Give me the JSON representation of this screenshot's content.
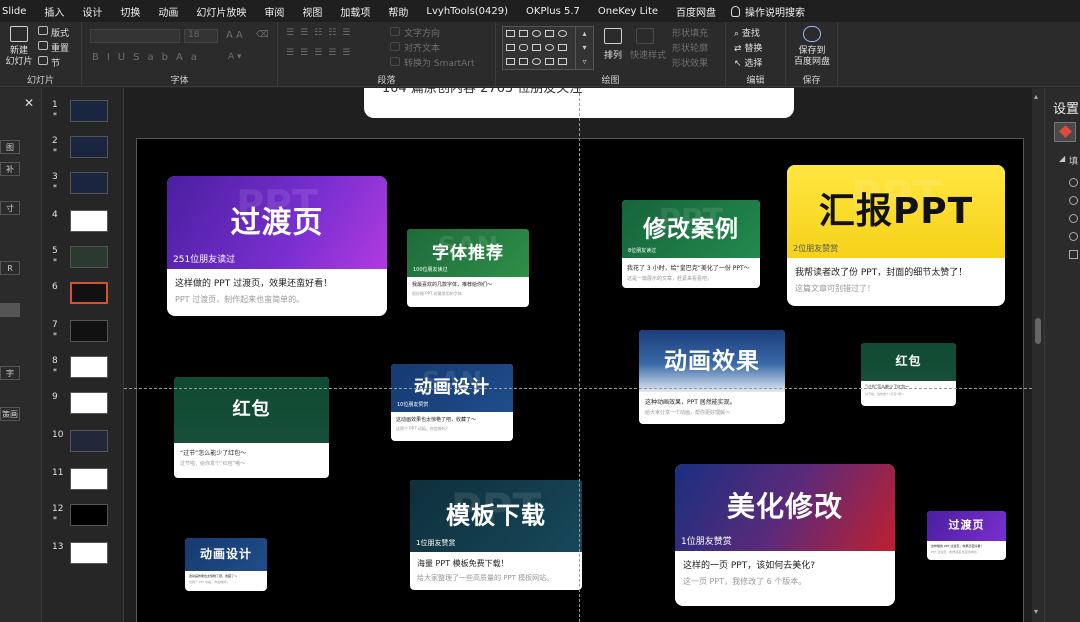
{
  "menu": [
    "Slide",
    "插入",
    "设计",
    "切换",
    "动画",
    "幻灯片放映",
    "审阅",
    "视图",
    "加载项",
    "帮助",
    "LvyhTools(0429)",
    "OKPlus 5.7",
    "OneKey Lite",
    "百度网盘"
  ],
  "tell_me": "操作说明搜索",
  "ribbon": {
    "new_slide": "新建\n幻灯片",
    "layout": "版式",
    "reset": "重置",
    "section": "节",
    "group_slides": "幻灯片",
    "font_size": "18",
    "group_font": "字体",
    "text_direction": "文字方向",
    "align_text": "对齐文本",
    "smartart": "转换为 SmartArt",
    "group_paragraph": "段落",
    "arrange": "排列",
    "quick_styles": "快速样式",
    "shape_fill": "形状填充",
    "shape_outline": "形状轮廓",
    "shape_effects": "形状效果",
    "group_drawing": "绘图",
    "find": "查找",
    "replace": "替换",
    "select": "选择",
    "group_editing": "编辑",
    "save_to": "保存到\n百度网盘",
    "group_save": "保存"
  },
  "left_panel": {
    "buttons": [
      "图",
      "补",
      "寸",
      "R",
      "字",
      "策画"
    ]
  },
  "right_panel": {
    "title": "设置",
    "sub": "填"
  },
  "thumbnails": [
    {
      "num": "1",
      "star": true,
      "bg": "#1a2540"
    },
    {
      "num": "2",
      "star": true,
      "bg": "#1a2540"
    },
    {
      "num": "3",
      "star": true,
      "bg": "#1a2540"
    },
    {
      "num": "4",
      "star": false,
      "bg": "#ffffff"
    },
    {
      "num": "5",
      "star": true,
      "bg": "#2a3a30"
    },
    {
      "num": "6",
      "star": false,
      "bg": "#111111",
      "selected": true
    },
    {
      "num": "7",
      "star": true,
      "bg": "#111111"
    },
    {
      "num": "8",
      "star": true,
      "bg": "#ffffff"
    },
    {
      "num": "9",
      "star": false,
      "bg": "#ffffff"
    },
    {
      "num": "10",
      "star": false,
      "bg": "#22283a"
    },
    {
      "num": "11",
      "star": false,
      "bg": "#ffffff"
    },
    {
      "num": "12",
      "star": true,
      "bg": "#000000"
    },
    {
      "num": "13",
      "star": false,
      "bg": "#ffffff"
    }
  ],
  "top_card_text": "104 篇原创内容  2763 位朋友关注",
  "cards": [
    {
      "title": "过渡页",
      "ghost": "PPT",
      "likes": "251位朋友读过",
      "heading": "这样做的 PPT 过渡页，效果还蛮好看！",
      "desc": "PPT 过渡页，制作起来也蛮简单的。",
      "bg": "linear-gradient(120deg,#4a1fa0 0%,#7a2fd0 60%,#b03be0 100%)"
    },
    {
      "title": "字体推荐",
      "ghost": "SAN",
      "likes": "100位朋友读过",
      "heading": "我最喜欢的几款字体，推荐给你们～",
      "desc": "很好做 PPT 时最常用的字体",
      "bg": "linear-gradient(135deg,#1e6a3a,#2f8f48)"
    },
    {
      "title": "修改案例",
      "ghost": "PPT",
      "likes": "8位朋友读过",
      "heading": "我花了 3 小时，给“皇巴克”美化了一份 PPT～",
      "desc": "这是一篇展示的文章，赶紧来看看吧。",
      "bg": "linear-gradient(135deg,#16643a,#238a4e)"
    },
    {
      "title": "汇报PPT",
      "ghost": "PPT",
      "likes": "2位朋友赞赏",
      "heading": "我帮读者改了份 PPT，封面的细节太赞了！",
      "desc": "这篇文章可别错过了！",
      "bg": "linear-gradient(180deg,#ffe640,#f5d21a)"
    },
    {
      "title": "红包",
      "ghost": "",
      "likes": "",
      "heading": "“过节”怎么能少了红包～",
      "desc": "过节啦，给你发个“红包”哦～",
      "bg": "linear-gradient(180deg,#0f4a32,#174f3a)"
    },
    {
      "title": "动画设计",
      "ghost": "SAN",
      "likes": "10位朋友赞赏",
      "heading": "这动画效果也太惊艳了吧，收藏了～",
      "desc": "这两个 PPT 动画，你会做吗？",
      "bg": "linear-gradient(135deg,#163a70,#1f4d8a)"
    },
    {
      "title": "动画效果",
      "ghost": "",
      "likes": "",
      "heading": "这种动画效果，PPT 居然能实现。",
      "desc": "给大家分享一个动画，帮你更好理解～",
      "bg": "linear-gradient(180deg,#1a3d7a 0%,#3a6aa8 55%,#dfe9f2 100%)"
    },
    {
      "title": "红包",
      "ghost": "",
      "likes": "",
      "heading": "“过节”怎么能少了红包～",
      "desc": "过节啦，给你发个“红包”哦～",
      "bg": "linear-gradient(180deg,#0f4a32,#174f3a)"
    },
    {
      "title": "模板下载",
      "ghost": "PPT",
      "likes": "1位朋友赞赏",
      "heading": "海量 PPT 模板免费下载！",
      "desc": "给大家整理了一些高质量的 PPT 模板网站。",
      "bg": "linear-gradient(135deg,#0e2f3c,#17485a)"
    },
    {
      "title": "美化修改",
      "ghost": "",
      "likes": "1位朋友赞赏",
      "heading": "这样的一页 PPT，该如何去美化?",
      "desc": "这一页 PPT，我修改了 6 个版本。",
      "bg": "linear-gradient(120deg,#1a2f80 0%,#5a2a7a 50%,#c02030 100%)"
    },
    {
      "title": "动画设计",
      "ghost": "",
      "likes": "",
      "heading": "这动画效果也太惊艳了吧，收藏了～",
      "desc": "这两个 PPT 动画，你会做吗？",
      "bg": "linear-gradient(135deg,#163a70,#1f4d8a)"
    },
    {
      "title": "过渡页",
      "ghost": "",
      "likes": "",
      "heading": "这样做的 PPT 过渡页，效果还蛮好看！",
      "desc": "PPT 过渡页，制作起来也蛮简单的。",
      "bg": "linear-gradient(120deg,#4a1fa0 0%,#7a2fd0 100%)"
    }
  ]
}
